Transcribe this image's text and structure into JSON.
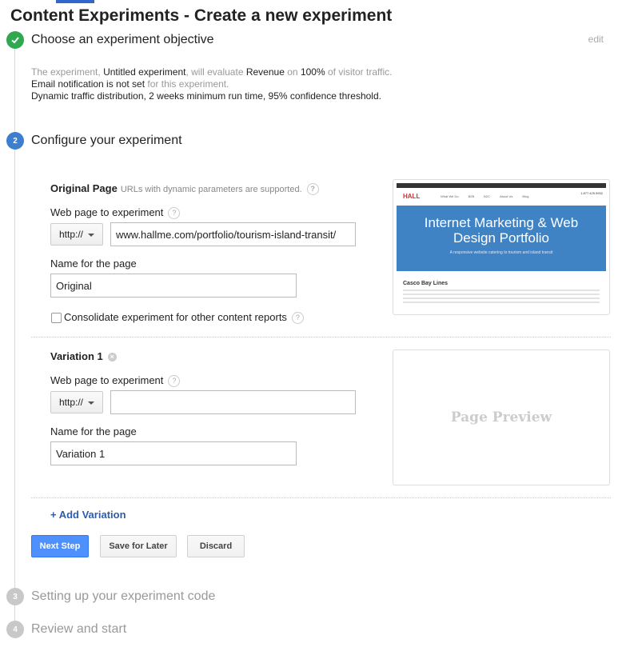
{
  "page": {
    "title": "Content Experiments - Create a new experiment"
  },
  "steps": [
    {
      "num": "",
      "title": "Choose an experiment objective"
    },
    {
      "num": "2",
      "title": "Configure your experiment"
    },
    {
      "num": "3",
      "title": "Setting up your experiment code"
    },
    {
      "num": "4",
      "title": "Review and start"
    }
  ],
  "edit_label": "edit",
  "summary": {
    "l1_a": "The experiment,",
    "l1_b": "Untitled experiment",
    "l1_c": ", will evaluate",
    "l1_d": "Revenue",
    "l1_e": "on",
    "l1_f": "100%",
    "l1_g": "of visitor traffic.",
    "l2_a": "Email notification is not set",
    "l2_b": "for this experiment.",
    "l3": "Dynamic traffic distribution, 2 weeks minimum run time, 95% confidence threshold."
  },
  "original": {
    "heading": "Original Page",
    "hint": "URLs with dynamic parameters are supported.",
    "web_label": "Web page to experiment",
    "protocol": "http://",
    "url": "www.hallme.com/portfolio/tourism-island-transit/",
    "name_label": "Name for the page",
    "name_value": "Original",
    "consolidate_label": "Consolidate experiment for other content reports"
  },
  "variation": {
    "heading": "Variation 1",
    "web_label": "Web page to experiment",
    "protocol": "http://",
    "url": "",
    "name_label": "Name for the page",
    "name_value": "Variation 1",
    "preview_placeholder": "Page Preview"
  },
  "thumbnail": {
    "headline_1": "Internet Marketing & Web",
    "headline_2": "Design Portfolio",
    "tagline": "A responsive website catering to tourism and island transit",
    "section": "Casco Bay Lines",
    "logo": "HALL",
    "nav": [
      "What We Do",
      "B2B",
      "B2C",
      "About Us",
      "Blog"
    ],
    "phone": "1.877.425.5932"
  },
  "add_variation": "+ Add Variation",
  "buttons": {
    "next": "Next Step",
    "save": "Save for Later",
    "discard": "Discard"
  },
  "colors": {
    "accent": "#4d90fe",
    "success": "#0f9d58",
    "step_active": "#3d7fce",
    "step_inactive": "#c8c8c8"
  }
}
